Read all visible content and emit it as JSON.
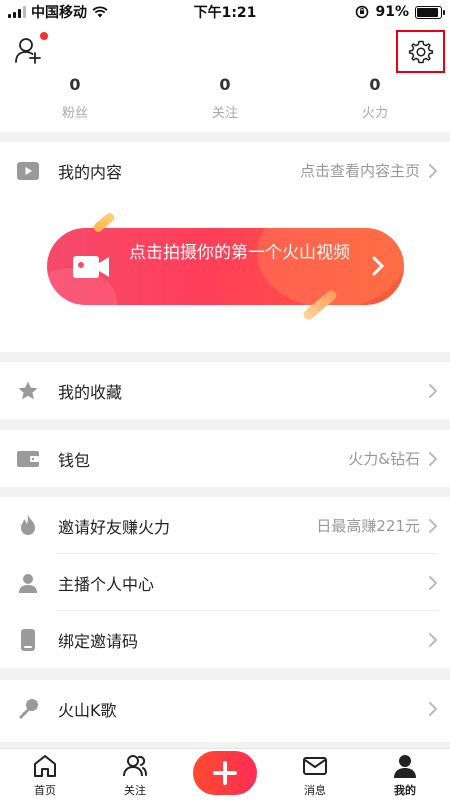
{
  "status_bar": {
    "carrier": "中国移动",
    "time": "下午1:21",
    "battery_percent": "91%",
    "battery_level": 0.91
  },
  "header": {
    "add_friend_icon": "add-user-icon",
    "settings_icon": "gear-icon",
    "has_notification_dot": true
  },
  "stats": [
    {
      "value": "0",
      "label": "粉丝"
    },
    {
      "value": "0",
      "label": "关注"
    },
    {
      "value": "0",
      "label": "火力"
    }
  ],
  "content_section": {
    "label": "我的内容",
    "value": "点击查看内容主页",
    "banner_text": "点击拍摄你的第一个火山视频"
  },
  "favorites": {
    "label": "我的收藏"
  },
  "wallet": {
    "label": "钱包",
    "value": "火力&钻石"
  },
  "invite_section": [
    {
      "label": "邀请好友赚火力",
      "value": "日最高赚221元",
      "icon": "flame-icon"
    },
    {
      "label": "主播个人中心",
      "value": "",
      "icon": "person-icon"
    },
    {
      "label": "绑定邀请码",
      "value": "",
      "icon": "phone-icon"
    }
  ],
  "karaoke": {
    "label": "火山K歌"
  },
  "bottom_nav": [
    {
      "label": "首页",
      "icon": "home-icon"
    },
    {
      "label": "关注",
      "icon": "follow-icon"
    },
    {
      "label": "",
      "icon": "plus-icon"
    },
    {
      "label": "消息",
      "icon": "message-icon"
    },
    {
      "label": "我的",
      "icon": "me-icon"
    }
  ],
  "colors": {
    "accent": "#ff2d55",
    "highlight_box": "#e60012"
  }
}
